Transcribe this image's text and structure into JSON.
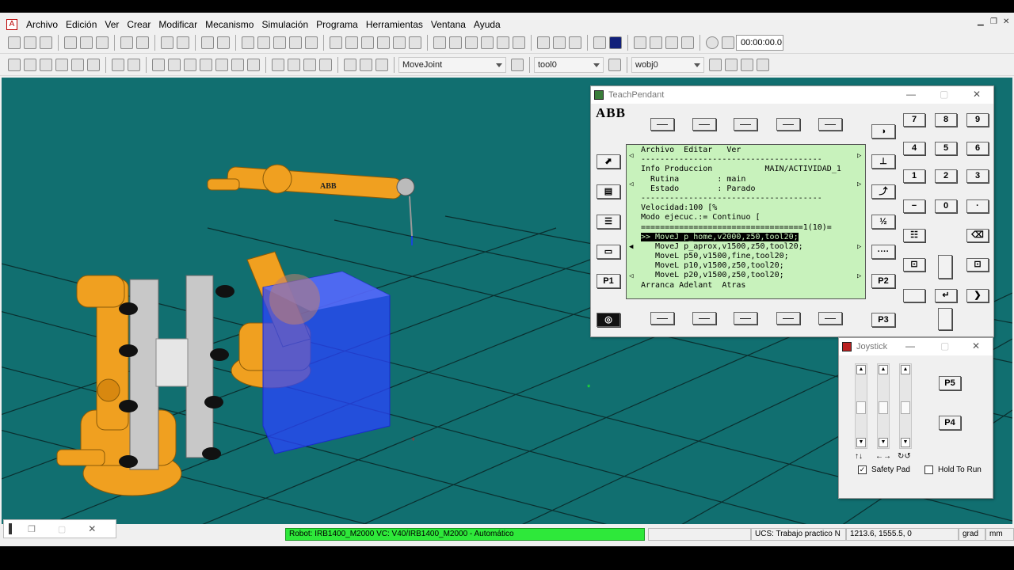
{
  "menu": [
    "Archivo",
    "Edición",
    "Ver",
    "Crear",
    "Modificar",
    "Mecanismo",
    "Simulación",
    "Programa",
    "Herramientas",
    "Ventana",
    "Ayuda"
  ],
  "toolbar": {
    "timer": "00:00:00.0",
    "movetype": "MoveJoint",
    "tool": "tool0",
    "wobj": "wobj0"
  },
  "teachpendant": {
    "title": "TeachPendant",
    "logo": "ABB",
    "p1": "P1",
    "p2": "P2",
    "p3": "P3",
    "screen": {
      "menu": "Archivo  Editar   Ver",
      "divider1": "--------------------------------------",
      "info": "Info Produccion           MAIN/ACTIVIDAD_1",
      "rutina": "  Rutina        : main",
      "estado": "  Estado        : Parado",
      "divider2": "--------------------------------------",
      "velocidad": "Velocidad:100 [%",
      "modo": "Modo ejecuc.:= Continuo [",
      "progline": "==================================1(10)=",
      "current": ">> MoveJ p_home,v2000,z50,tool20;",
      "lines": [
        "   MoveJ p_aprox,v1500,z50,tool20;",
        "   MoveL p50,v1500,fine,tool20;",
        "   MoveL p10,v1500,z50,tool20;",
        "   MoveL p20,v1500,z50,tool20;"
      ],
      "bottom": "Arranca Adelant  Atras"
    },
    "numpad": [
      "7",
      "8",
      "9",
      "4",
      "5",
      "6",
      "1",
      "2",
      "3",
      "−",
      "0",
      "·"
    ]
  },
  "joystick": {
    "title": "Joystick",
    "p5": "P5",
    "p4": "P4",
    "axis_labels": [
      "↑↓",
      "←→",
      "↻↺"
    ],
    "safety": "Safety Pad",
    "safety_checked": "✓",
    "hold": "Hold To Run"
  },
  "status": {
    "robot": "Robot: IRB1400_M2000   VC: V40/IRB1400_M2000 - Automático",
    "ucs": "UCS: Trabajo practico N",
    "coords": "1213.6, 1555.5, 0",
    "angle_unit": "grad",
    "length_unit": "mm",
    "robot_color": "#2ee83a"
  },
  "viewport_color": "#116f70"
}
